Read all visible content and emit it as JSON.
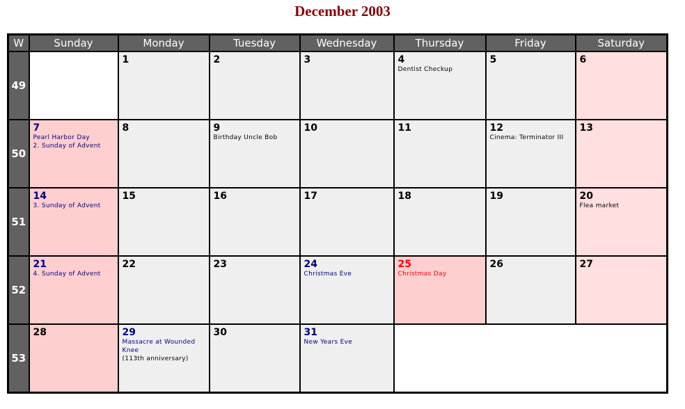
{
  "title": "December 2003",
  "headers": {
    "week": "W",
    "days": [
      "Sunday",
      "Monday",
      "Tuesday",
      "Wednesday",
      "Thursday",
      "Friday",
      "Saturday"
    ]
  },
  "colors": {
    "title": "#8b0000",
    "header_bg": "#616161",
    "weekday_bg": "#efefef",
    "sunday_bg": "#ffcfcf",
    "saturday_bg": "#ffdfdf",
    "holiday_text": "#000080",
    "christmas_text": "#ff0000"
  },
  "weeks": [
    {
      "number": "49",
      "days": [
        {
          "date": "",
          "events": []
        },
        {
          "date": "1",
          "events": []
        },
        {
          "date": "2",
          "events": []
        },
        {
          "date": "3",
          "events": []
        },
        {
          "date": "4",
          "events": [
            "Dentist Checkup"
          ]
        },
        {
          "date": "5",
          "events": []
        },
        {
          "date": "6",
          "events": []
        }
      ]
    },
    {
      "number": "50",
      "days": [
        {
          "date": "7",
          "events": [
            "Pearl Harbor Day",
            "2. Sunday of Advent"
          ]
        },
        {
          "date": "8",
          "events": []
        },
        {
          "date": "9",
          "events": [
            "Birthday Uncle Bob"
          ]
        },
        {
          "date": "10",
          "events": []
        },
        {
          "date": "11",
          "events": []
        },
        {
          "date": "12",
          "events": [
            "Cinema: Terminator III"
          ]
        },
        {
          "date": "13",
          "events": []
        }
      ]
    },
    {
      "number": "51",
      "days": [
        {
          "date": "14",
          "events": [
            "3. Sunday of Advent"
          ]
        },
        {
          "date": "15",
          "events": []
        },
        {
          "date": "16",
          "events": []
        },
        {
          "date": "17",
          "events": []
        },
        {
          "date": "18",
          "events": []
        },
        {
          "date": "19",
          "events": []
        },
        {
          "date": "20",
          "events": [
            "Flea market"
          ]
        }
      ]
    },
    {
      "number": "52",
      "days": [
        {
          "date": "21",
          "events": [
            "4. Sunday of Advent"
          ]
        },
        {
          "date": "22",
          "events": []
        },
        {
          "date": "23",
          "events": []
        },
        {
          "date": "24",
          "events": [
            "Christmas Eve"
          ]
        },
        {
          "date": "25",
          "events": [
            "Christmas Day"
          ]
        },
        {
          "date": "26",
          "events": []
        },
        {
          "date": "27",
          "events": []
        }
      ]
    },
    {
      "number": "53",
      "days": [
        {
          "date": "28",
          "events": []
        },
        {
          "date": "29",
          "events": [
            "Massacre at Wounded",
            "Knee",
            "(113th anniversary)"
          ]
        },
        {
          "date": "30",
          "events": []
        },
        {
          "date": "31",
          "events": [
            "New Years Eve"
          ]
        }
      ]
    }
  ]
}
